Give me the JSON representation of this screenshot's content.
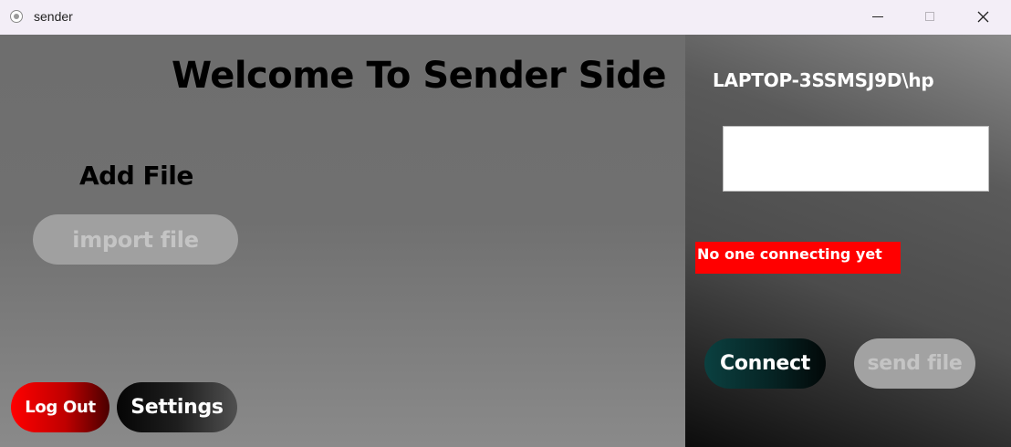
{
  "window": {
    "title": "sender",
    "controls": {
      "minimize": "minimize-icon",
      "maximize": "maximize-icon",
      "close": "close-icon"
    }
  },
  "left": {
    "heading": "Welcome To Sender Side",
    "add_file_label": "Add File",
    "import_button": "import file",
    "logout_button": "Log Out",
    "settings_button": "Settings"
  },
  "right": {
    "machine_name": "LAPTOP-3SSMSJ9D\\hp",
    "code_input_value": "",
    "status_message": "No one connecting yet",
    "connect_button": "Connect",
    "send_file_button": "send file"
  },
  "colors": {
    "status_bg": "#ff0000",
    "logout_accent": "#ff0000",
    "connect_accent": "#0b4040",
    "disabled_button": "#a0a0a0"
  }
}
